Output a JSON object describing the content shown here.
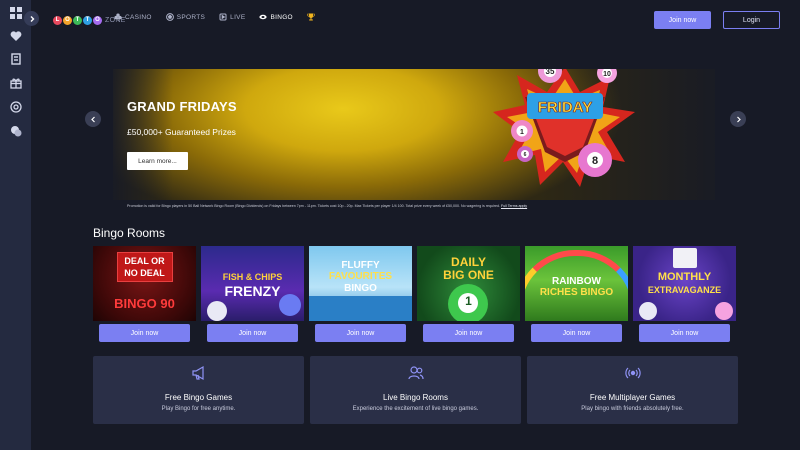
{
  "logo": {
    "letters": [
      "L",
      "O",
      "T",
      "T",
      "O"
    ],
    "colors": [
      "#e84a5f",
      "#f4a42b",
      "#3dbb58",
      "#2fa0e4",
      "#a66cf0"
    ],
    "suffix": "ZONE"
  },
  "nav": [
    {
      "label": "CASINO",
      "icon": "clubs-icon"
    },
    {
      "label": "SPORTS",
      "icon": "soccer-ball-icon"
    },
    {
      "label": "LIVE",
      "icon": "live-icon"
    },
    {
      "label": "BINGO",
      "icon": "bingo-ball-icon",
      "active": true
    },
    {
      "label": "",
      "icon": "trophy-icon"
    }
  ],
  "header": {
    "join_label": "Join now",
    "login_label": "Login"
  },
  "sidebar": {
    "icons": [
      "grid-icon",
      "heart-icon",
      "receipt-icon",
      "gift-icon",
      "target-icon",
      "chat-icon"
    ]
  },
  "hero": {
    "title": "GRAND FRIDAYS",
    "subtitle": "£50,000+ Guaranteed Prizes",
    "cta": "Learn more...",
    "terms": "Promotion is valid for Bingo players in 50 Ball Network Bingo Room (Bingo Dividends) on Fridays between 7pm - 11pm. Tickets cost 10p - 20p. Max Tickets per player 1/4 100. Total prize every week of £50,000. No wagering is required.",
    "terms_link": "Full Terms apply",
    "art_text": "FRIDAY",
    "art_balls": [
      "35",
      "10",
      "1",
      "6",
      "8"
    ]
  },
  "bingo_rooms": {
    "title": "Bingo Rooms",
    "games": [
      {
        "name": "DEAL OR NO DEAL BINGO 90",
        "play_label": "Join now",
        "line1": "DEAL OR",
        "line2": "NO DEAL",
        "line3": "BINGO 90"
      },
      {
        "name": "FISH & CHIPS FRENZY",
        "play_label": "Join now",
        "line1": "FISH & CHIPS",
        "line2": "FRENZY",
        "line3": ""
      },
      {
        "name": "FLUFFY FAVOURITES BINGO",
        "play_label": "Join now",
        "line1": "FLUFFY",
        "line2": "FAVOURITES",
        "line3": "BINGO"
      },
      {
        "name": "DAILY BIG ONE",
        "play_label": "Join now",
        "line1": "DAILY",
        "line2": "BIG ONE",
        "line3": "1"
      },
      {
        "name": "RAINBOW RICHES BINGO",
        "play_label": "Join now",
        "line1": "RAINBOW",
        "line2": "RICHES BINGO",
        "line3": ""
      },
      {
        "name": "MONTHLY EXTRAVAGANZE",
        "play_label": "Join now",
        "line1": "MONTHLY",
        "line2": "EXTRAVAGANZE",
        "line3": ""
      }
    ]
  },
  "features": [
    {
      "title": "Free Bingo Games",
      "desc": "Play Bingo for free anytime.",
      "icon": "megaphone-icon"
    },
    {
      "title": "Live Bingo Rooms",
      "desc": "Experience the excitement of live bingo games.",
      "icon": "users-icon"
    },
    {
      "title": "Free Multiplayer Games",
      "desc": "Play bingo with friends absolutely free.",
      "icon": "broadcast-icon"
    }
  ]
}
